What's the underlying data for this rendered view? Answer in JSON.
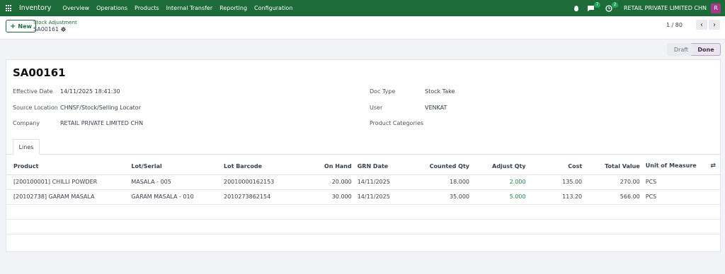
{
  "topbar": {
    "app_name": "Inventory",
    "menu": [
      "Overview",
      "Operations",
      "Products",
      "Internal Transfer",
      "Reporting",
      "Configuration"
    ],
    "chat_count": "7",
    "activity_count": "2",
    "company": "RETAIL PRIVATE LIMITED CHN",
    "avatar_letter": "R",
    "accent": "#1e6b3a"
  },
  "control_panel": {
    "new_label": "New",
    "breadcrumb": "Stock Adjustment",
    "record_name": "SA00161",
    "pager": "1 / 80"
  },
  "statusbar": {
    "draft": "Draft",
    "done": "Done"
  },
  "form": {
    "title": "SA00161",
    "effective_date_label": "Effective Date",
    "effective_date": "14/11/2025 18:41:30",
    "source_location_label": "Source Location",
    "source_location": "CHNSF/Stock/Selling Locator",
    "company_label": "Company",
    "company": "RETAIL PRIVATE LIMITED CHN",
    "doc_type_label": "Doc Type",
    "doc_type": "Stock Take",
    "user_label": "User",
    "user": "VENKAT",
    "product_categories_label": "Product Categories"
  },
  "tabs": {
    "lines": "Lines"
  },
  "table": {
    "columns": [
      "Product",
      "Lot/Serial",
      "Lot Barcode",
      "On Hand",
      "GRN Date",
      "Counted Qty",
      "Adjust Qty",
      "Cost",
      "Total Value",
      "Unit of Measure"
    ],
    "rows": [
      [
        "[200100001] CHILLI POWDER",
        "MASALA - 005",
        "20010000162153",
        "20.000",
        "14/11/2025",
        "18.000",
        "2.000",
        "135.00",
        "270.00",
        "PCS"
      ],
      [
        "[20102738] GARAM MASALA",
        "GARAM MASALA - 010",
        "2010273862154",
        "30.000",
        "14/11/2025",
        "35.000",
        "5.000",
        "113.20",
        "566.00",
        "PCS"
      ]
    ]
  }
}
